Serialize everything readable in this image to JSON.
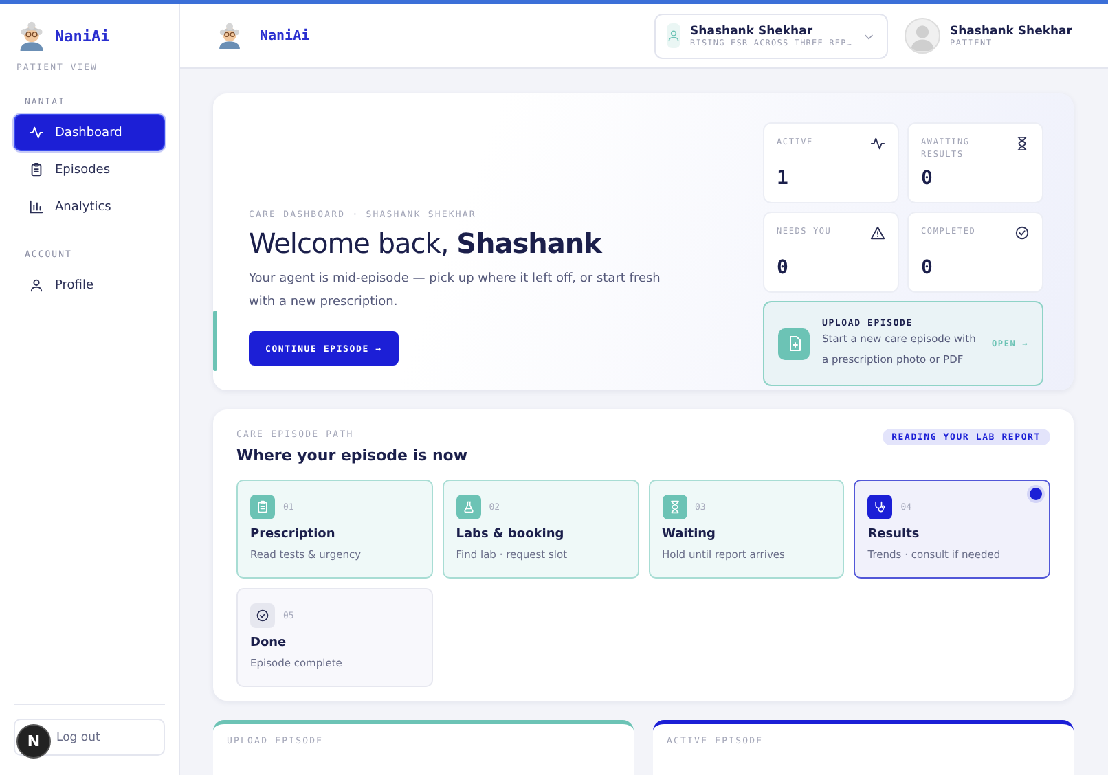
{
  "brand": {
    "name": "NaniAi"
  },
  "sidebar": {
    "view_label": "PATIENT VIEW",
    "sections": [
      {
        "title": "NANIAI",
        "items": [
          {
            "label": "Dashboard",
            "kind": "pulse",
            "selected": true
          },
          {
            "label": "Episodes",
            "kind": "clipboard",
            "selected": false
          },
          {
            "label": "Analytics",
            "kind": "chart",
            "selected": false
          }
        ]
      },
      {
        "title": "ACCOUNT",
        "items": [
          {
            "label": "Profile",
            "kind": "user",
            "selected": false
          }
        ]
      }
    ],
    "logout": "Log out"
  },
  "header": {
    "brand": "NaniAi",
    "patient_select": {
      "name": "Shashank Shekhar",
      "subtitle": "RISING ESR ACROSS THREE REP…"
    },
    "user": {
      "name": "Shashank Shekhar",
      "role": "PATIENT"
    }
  },
  "hero": {
    "eyebrow": "CARE DASHBOARD · SHASHANK SHEKHAR",
    "greeting": "Welcome back, **Shashank**",
    "description": "Your agent is mid-episode — pick up where it left off, or start fresh with a new prescription.",
    "button": "CONTINUE EPISODE →",
    "stats": [
      {
        "label": "ACTIVE",
        "value": "1",
        "kind": "pulse"
      },
      {
        "label": "AWAITING RESULTS",
        "value": "0",
        "kind": "hourglass"
      },
      {
        "label": "NEEDS YOU",
        "value": "0",
        "kind": "warning"
      },
      {
        "label": "COMPLETED",
        "value": "0",
        "kind": "check"
      }
    ],
    "upload": {
      "title": "UPLOAD EPISODE",
      "description": "Start a new care episode with a prescription photo or PDF",
      "link": "OPEN →"
    }
  },
  "path": {
    "eyebrow": "CARE EPISODE PATH",
    "title": "Where your episode is now",
    "status": "READING YOUR LAB REPORT",
    "steps": [
      {
        "number": "01",
        "title": "Prescription",
        "subtitle": "Read tests & urgency",
        "kind": "clipboard",
        "done": true,
        "selected": false
      },
      {
        "number": "02",
        "title": "Labs & booking",
        "subtitle": "Find lab · request slot",
        "kind": "flask",
        "done": true,
        "selected": false
      },
      {
        "number": "03",
        "title": "Waiting",
        "subtitle": "Hold until report arrives",
        "kind": "hourglass",
        "done": true,
        "selected": false
      },
      {
        "number": "04",
        "title": "Results",
        "subtitle": "Trends · consult if needed",
        "kind": "stethoscope",
        "done": false,
        "selected": true
      },
      {
        "number": "05",
        "title": "Done",
        "subtitle": "Episode complete",
        "kind": "check",
        "done": false,
        "selected": false
      }
    ]
  },
  "bottom_cards": [
    {
      "label": "UPLOAD EPISODE",
      "color": "#6cc3b5"
    },
    {
      "label": "ACTIVE EPISODE",
      "color": "#1c1fd6"
    }
  ],
  "dev_badge": "N"
}
